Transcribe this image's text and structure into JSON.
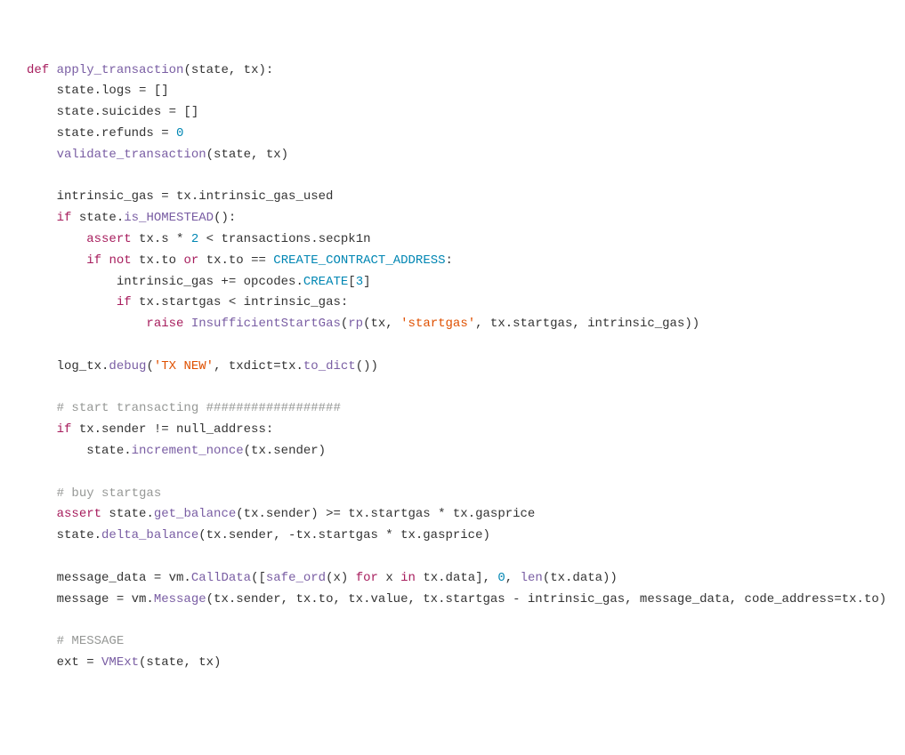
{
  "code": {
    "l1": {
      "def": "def",
      "fn": "apply_transaction",
      "params": "(state, tx):"
    },
    "l2": "    state.logs = []",
    "l3": "    state.suicides = []",
    "l4": {
      "pre": "    state.refunds = ",
      "num": "0"
    },
    "l5": {
      "pre": "    ",
      "fn": "validate_transaction",
      "post": "(state, tx)"
    },
    "l6": "",
    "l7": "    intrinsic_gas = tx.intrinsic_gas_used",
    "l8": {
      "pre": "    ",
      "kw": "if",
      "mid": " state.",
      "fn": "is_HOMESTEAD",
      "post": "():"
    },
    "l9": {
      "pre": "        ",
      "kw": "assert",
      "mid1": " tx.s * ",
      "num": "2",
      "mid2": " < transactions.secpk1n"
    },
    "l10": {
      "pre": "        ",
      "kw1": "if",
      "sp1": " ",
      "kw2": "not",
      "mid1": " tx.to ",
      "kw3": "or",
      "mid2": " tx.to == ",
      "const": "CREATE_CONTRACT_ADDRESS",
      "post": ":"
    },
    "l11": {
      "pre": "            intrinsic_gas += opcodes.",
      "const": "CREATE",
      "mid": "[",
      "num": "3",
      "post": "]"
    },
    "l12": {
      "pre": "            ",
      "kw": "if",
      "post": " tx.startgas < intrinsic_gas:"
    },
    "l13": {
      "pre": "                ",
      "kw": "raise",
      "sp": " ",
      "fn": "InsufficientStartGas",
      "mid1": "(",
      "fn2": "rp",
      "mid2": "(tx, ",
      "str": "'startgas'",
      "post": ", tx.startgas, intrinsic_gas))"
    },
    "l14": "",
    "l15": {
      "pre": "    log_tx.",
      "fn": "debug",
      "mid1": "(",
      "str": "'TX NEW'",
      "mid2": ", txdict=tx.",
      "fn2": "to_dict",
      "post": "())"
    },
    "l16": "",
    "l17": {
      "pre": "    ",
      "cmt": "# start transacting ##################"
    },
    "l18": {
      "pre": "    ",
      "kw": "if",
      "post": " tx.sender != null_address:"
    },
    "l19": {
      "pre": "        state.",
      "fn": "increment_nonce",
      "post": "(tx.sender)"
    },
    "l20": "",
    "l21": {
      "pre": "    ",
      "cmt": "# buy startgas"
    },
    "l22": {
      "pre": "    ",
      "kw": "assert",
      "mid": " state.",
      "fn": "get_balance",
      "post": "(tx.sender) >= tx.startgas * tx.gasprice"
    },
    "l23": {
      "pre": "    state.",
      "fn": "delta_balance",
      "post": "(tx.sender, -tx.startgas * tx.gasprice)"
    },
    "l24": "",
    "l25": {
      "pre": "    message_data = vm.",
      "fn": "CallData",
      "mid1": "([",
      "fn2": "safe_ord",
      "mid2": "(x) ",
      "kw1": "for",
      "mid3": " x ",
      "kw2": "in",
      "mid4": " tx.data], ",
      "num1": "0",
      "mid5": ", ",
      "fn3": "len",
      "post": "(tx.data))"
    },
    "l26": {
      "pre": "    message = vm.",
      "fn": "Message",
      "post": "(tx.sender, tx.to, tx.value, tx.startgas - intrinsic_gas, message_data, code_address=tx.to)"
    },
    "l27": "",
    "l28": {
      "pre": "    ",
      "cmt": "# MESSAGE"
    },
    "l29": {
      "pre": "    ext = ",
      "fn": "VMExt",
      "post": "(state, tx)"
    }
  }
}
